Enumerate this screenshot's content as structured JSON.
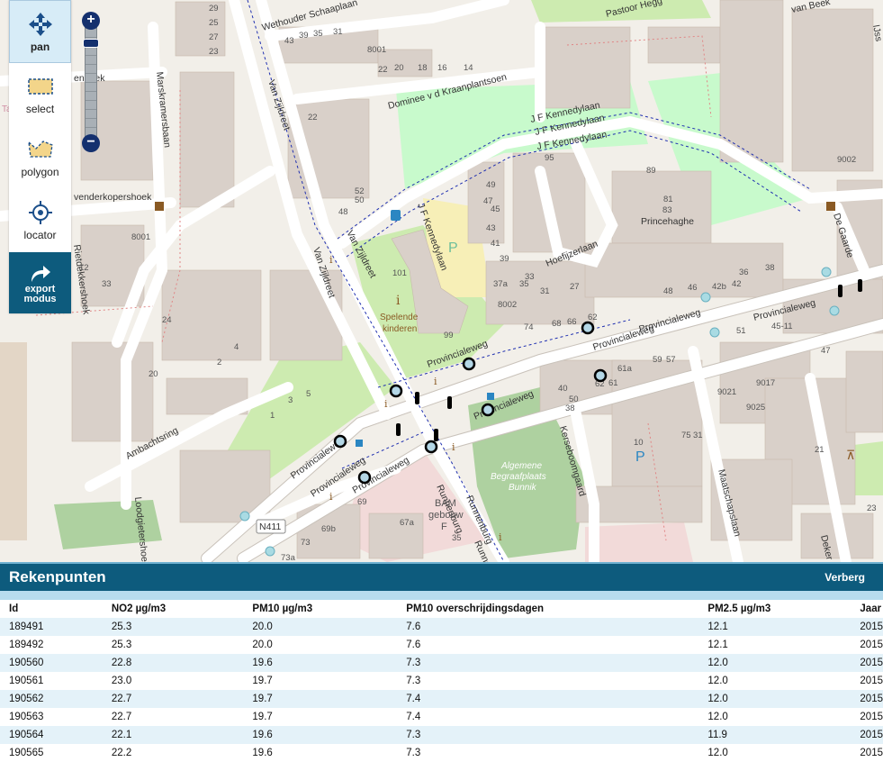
{
  "toolbar": {
    "pan": "pan",
    "select": "select",
    "polygon": "polygon",
    "locator": "locator",
    "export_line1": "export",
    "export_line2": "modus",
    "icons": {
      "pan": "move-arrows-icon",
      "select": "select-rectangle-icon",
      "polygon": "polygon-icon",
      "locator": "crosshair-icon",
      "export": "share-arrow-icon"
    }
  },
  "zoom": {
    "in": "+",
    "out": "−"
  },
  "map": {
    "streets": {
      "wethouder": "Wethouder Schaaplaan",
      "pastoor": "Pastoor Hegg",
      "van_beek": "van Beek",
      "dominee": "Dominee v d Kraanplantsoen",
      "kennedy1": "J F Kennedylaan",
      "kennedy2": "J F Kennedylaan",
      "kennedy3": "J F Kennedylaan",
      "kennedy_v": "J F Kennedylaan",
      "van_zijldreet1": "Van Zijldreet",
      "van_zijldreet2": "Van Zijldreet",
      "van_zijldreet3": "Van Zijldreet",
      "marskramers": "Marskramersbaan",
      "venderkoper": "venderkopershoek",
      "enhoek": "enhoek",
      "rietdekkers": "Rietdekkershoek",
      "ambachtsring": "Ambachtsring",
      "loodgieters": "Loodgietershoek",
      "princehaghe": "Princehaghe",
      "hoefijzer": "Hoefijzerlaan",
      "provinciale1": "Provincialeweg",
      "provinciale2": "Provincialeweg",
      "provinciale3": "Provincialeweg",
      "provinciale4": "Provincialeweg",
      "provinciale5": "Provincialeweg",
      "provinciale6": "Provincialeweg",
      "provinciale7": "Provincialeweg",
      "kerseboom": "Kerseboomgaard",
      "maatschaps": "Maatschapslaan",
      "runnenburg1": "Runnenburg",
      "runnenburg2": "Runnenburg",
      "runnen3": "Runnen",
      "de_gaarde": "De Gaarde",
      "deker": "Deker",
      "ijssel": "IJss"
    },
    "pois": {
      "spelende1": "Spelende",
      "spelende2": "kinderen",
      "begraaf1": "Algemene",
      "begraaf2": "Begraafplaats",
      "begraaf3": "Bunnik",
      "bam1": "BAM",
      "bam2": "gebouw",
      "bam3": "F",
      "n411": "N411",
      "p": "P",
      "ta": "Ta"
    },
    "numbers": {
      "n1": "29",
      "n2": "25",
      "n3": "27",
      "n4": "23",
      "n5": "43",
      "n6": "39",
      "n7": "35",
      "n8": "31",
      "n9": "8001",
      "n10": "22",
      "n11": "20",
      "n12": "18",
      "n13": "16",
      "n14": "14",
      "n15": "101",
      "n16": "99",
      "n17": "49",
      "n18": "47",
      "n19": "45",
      "n20": "43",
      "n21": "41",
      "n22": "39",
      "n23": "37a",
      "n24": "35",
      "n25": "33",
      "n26": "31",
      "n27": "27",
      "n28": "8002",
      "n29": "74",
      "n30": "68",
      "n31": "66",
      "n32": "62",
      "n33": "61a",
      "n34": "61",
      "n35": "59",
      "n36": "57",
      "n37": "48",
      "n38": "46",
      "n39": "42b",
      "n40": "42",
      "n41": "36",
      "n42": "38",
      "n43": "9021",
      "n44": "9017",
      "n45": "9025",
      "n46": "10",
      "n47": "75",
      "n48": "31",
      "n49": "69",
      "n50": "69b",
      "n51": "67a",
      "n52": "73",
      "n53": "73a",
      "n54": "35",
      "n55": "8001",
      "n56": "9002",
      "n57": "52",
      "n58": "50",
      "n59": "48",
      "n60": "24",
      "n61": "20",
      "n62": "12",
      "n63": "33",
      "n64": "22",
      "n65": "4",
      "n66": "2",
      "n67": "1",
      "n68": "3",
      "n69": "5",
      "n70": "95",
      "n71": "89",
      "n72": "81",
      "n73": "83",
      "n74": "51",
      "n75": "45-11",
      "n76": "47",
      "n77": "21",
      "n78": "23",
      "n79": "40",
      "n80": "50",
      "n81": "38",
      "n82": "62"
    }
  },
  "panel": {
    "title": "Rekenpunten",
    "hide": "Verberg",
    "columns": [
      "Id",
      "NO2 µg/m3",
      "PM10 µg/m3",
      "PM10 overschrijdingsdagen",
      "PM2.5 µg/m3",
      "Jaar"
    ],
    "rows": [
      [
        "189491",
        "25.3",
        "20.0",
        "7.6",
        "12.1",
        "2015"
      ],
      [
        "189492",
        "25.3",
        "20.0",
        "7.6",
        "12.1",
        "2015"
      ],
      [
        "190560",
        "22.8",
        "19.6",
        "7.3",
        "12.0",
        "2015"
      ],
      [
        "190561",
        "23.0",
        "19.7",
        "7.3",
        "12.0",
        "2015"
      ],
      [
        "190562",
        "22.7",
        "19.7",
        "7.4",
        "12.0",
        "2015"
      ],
      [
        "190563",
        "22.7",
        "19.7",
        "7.4",
        "12.0",
        "2015"
      ],
      [
        "190564",
        "22.1",
        "19.6",
        "7.3",
        "11.9",
        "2015"
      ],
      [
        "190565",
        "22.2",
        "19.6",
        "7.3",
        "12.0",
        "2015"
      ]
    ]
  }
}
